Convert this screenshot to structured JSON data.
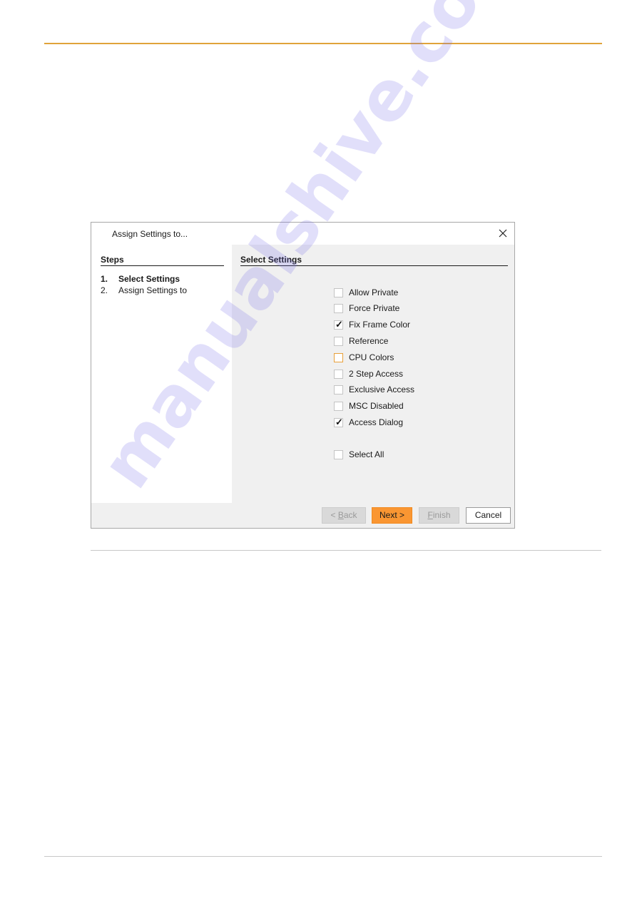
{
  "dialog": {
    "title": "Assign Settings to...",
    "close_icon": "close-icon"
  },
  "steps": {
    "heading": "Steps",
    "items": [
      {
        "num": "1.",
        "label": "Select Settings",
        "active": true
      },
      {
        "num": "2.",
        "label": "Assign Settings to",
        "active": false
      }
    ]
  },
  "settings": {
    "heading": "Select Settings",
    "options": [
      {
        "label": "Allow Private",
        "checked": false,
        "tick": ""
      },
      {
        "label": "Force Private",
        "checked": false,
        "tick": ""
      },
      {
        "label": "Fix Frame Color",
        "checked": true,
        "tick": "✓"
      },
      {
        "label": "Reference",
        "checked": false,
        "tick": ""
      },
      {
        "label": "CPU Colors",
        "checked": false,
        "focused": true,
        "tick": ""
      },
      {
        "label": "2 Step Access",
        "checked": false,
        "tick": ""
      },
      {
        "label": "Exclusive Access",
        "checked": false,
        "tick": ""
      },
      {
        "label": "MSC Disabled",
        "checked": false,
        "tick": ""
      },
      {
        "label": "Access Dialog",
        "checked": true,
        "tick": "✓"
      }
    ],
    "select_all": {
      "label": "Select All",
      "checked": false,
      "tick": ""
    }
  },
  "buttons": {
    "back_prefix": "< ",
    "back_accel": "B",
    "back_rest": "ack",
    "next": "Next >",
    "finish_accel": "F",
    "finish_rest": "inish",
    "cancel": "Cancel"
  },
  "colors": {
    "accent": "#fa9632",
    "header_rule": "#e0a33a"
  },
  "watermark": "manualshive.com"
}
